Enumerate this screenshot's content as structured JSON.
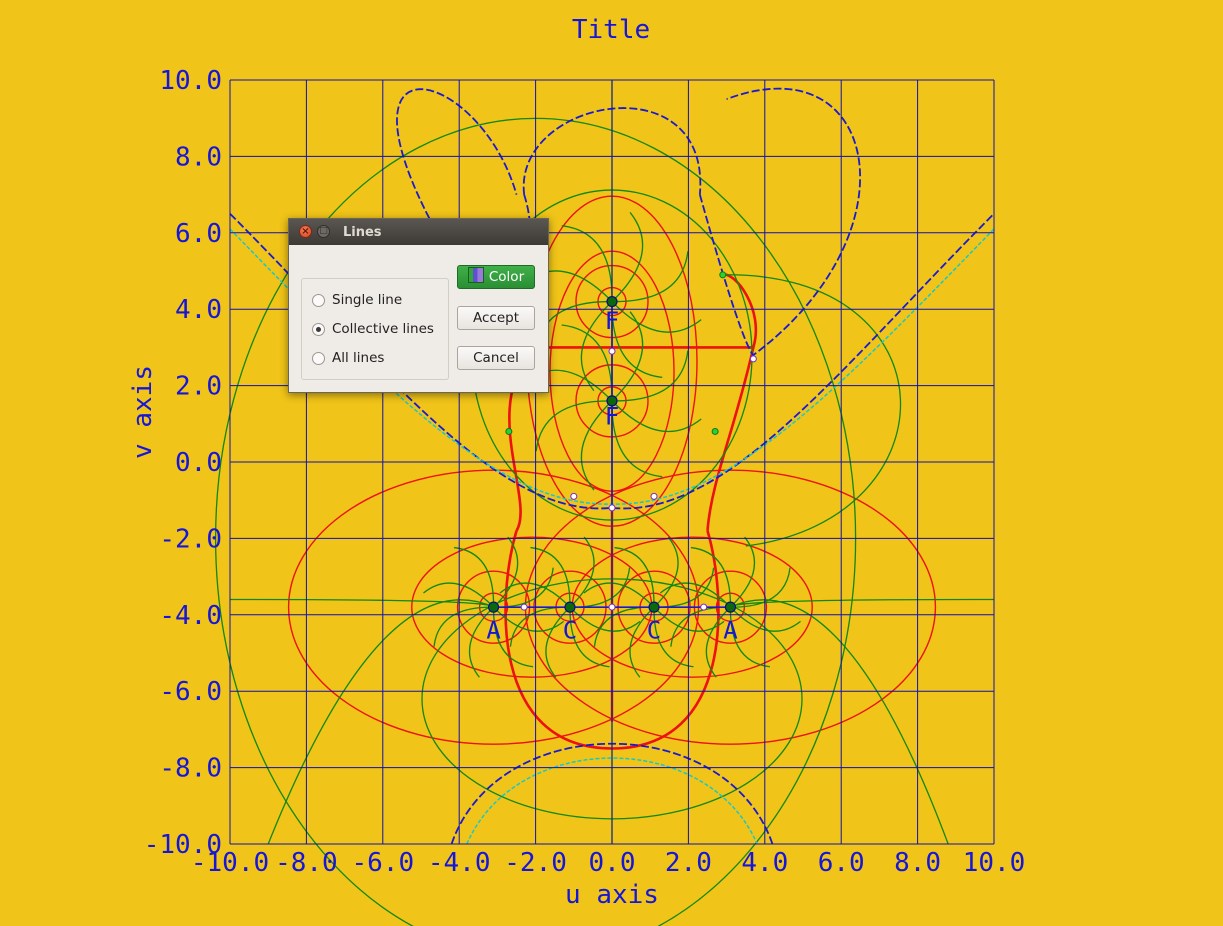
{
  "chart_data": {
    "type": "line",
    "title": "Title",
    "xlabel": "u axis",
    "ylabel": "v axis",
    "xlim": [
      -10.0,
      10.0
    ],
    "ylim": [
      -10.0,
      10.0
    ],
    "x_ticks": [
      "-10.0",
      "-8.0",
      "-6.0",
      "-4.0",
      "-2.0",
      "0.0",
      "2.0",
      "4.0",
      "6.0",
      "8.0",
      "10.0"
    ],
    "y_ticks": [
      "10.0",
      "8.0",
      "6.0",
      "4.0",
      "2.0",
      "0.0",
      "-2.0",
      "-4.0",
      "-6.0",
      "-8.0",
      "-10.0"
    ],
    "grid": true,
    "point_labels": [
      {
        "text": "F",
        "x": 0.0,
        "y": 3.9
      },
      {
        "text": "F",
        "x": 0.0,
        "y": 1.4
      },
      {
        "text": "A",
        "x": -3.1,
        "y": -4.2
      },
      {
        "text": "C",
        "x": -1.1,
        "y": -4.2
      },
      {
        "text": "C",
        "x": 1.1,
        "y": -4.2
      },
      {
        "text": "A",
        "x": 3.1,
        "y": -4.2
      }
    ],
    "poles": [
      {
        "x": 0.0,
        "y": 4.2
      },
      {
        "x": 0.0,
        "y": 1.6
      },
      {
        "x": -3.1,
        "y": -3.8
      },
      {
        "x": -1.1,
        "y": -3.8
      },
      {
        "x": 1.1,
        "y": -3.8
      },
      {
        "x": 3.1,
        "y": -3.8
      }
    ],
    "colors": {
      "background": "#f0c418",
      "grid": "#1010b0",
      "text": "#1616d8",
      "field_lines": "#118811",
      "equipotential": "#ee1111",
      "separatrix": "#1a1ad0"
    }
  },
  "dialog": {
    "title": "Lines",
    "radio_options": [
      "Single line",
      "Collective lines",
      "All lines"
    ],
    "selected": "Collective lines",
    "color_button": "Color",
    "accept_button": "Accept",
    "cancel_button": "Cancel",
    "close_icon": "close-icon",
    "maximize_icon": "maximize-icon"
  }
}
